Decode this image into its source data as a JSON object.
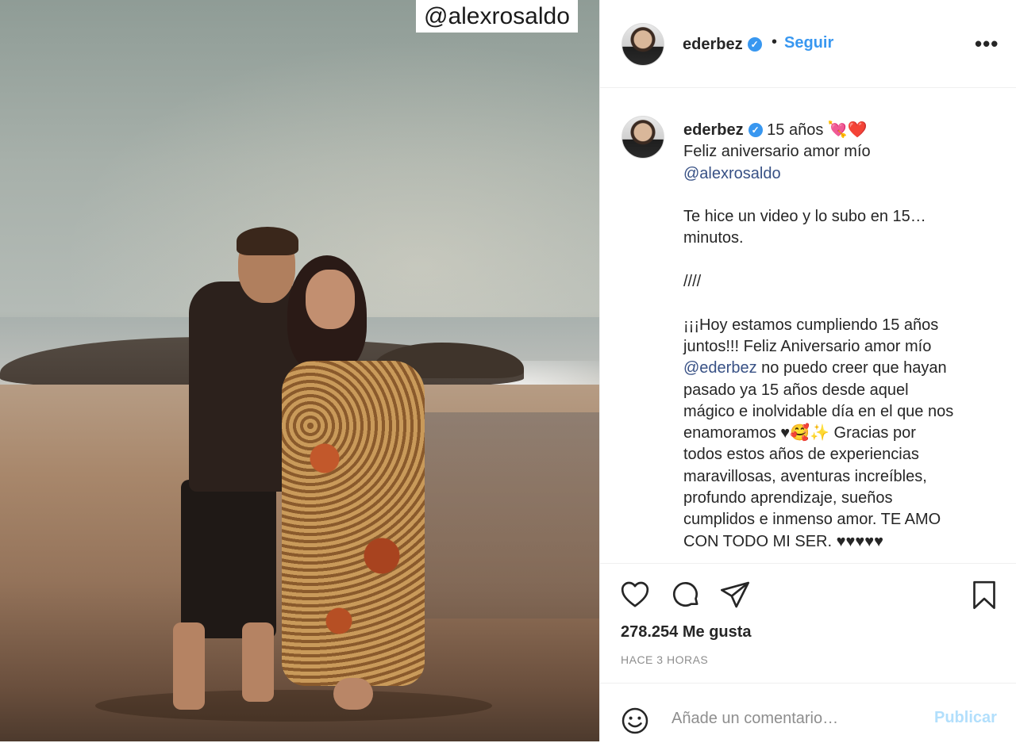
{
  "photo": {
    "watermark": "@alexrosaldo"
  },
  "header": {
    "username": "ederbez",
    "separator": "•",
    "follow_label": "Seguir",
    "more_label": "•••"
  },
  "caption": {
    "username": "ederbez",
    "line1": " 15 años ",
    "emoji1": "💘",
    "emoji2": "❤️",
    "line2": "Feliz aniversario amor mío",
    "mention1": "@alexrosaldo",
    "para2": "Te hice un video y lo subo en 15…\nminutos.",
    "para3": "////",
    "para4a": "¡¡¡Hoy estamos cumpliendo 15 años\njuntos!!! Feliz Aniversario amor mío\n",
    "mention2": "@ederbez",
    "para4b": " no puedo creer que hayan\npasado ya 15 años desde aquel\nmágico e inolvidable día en el que nos\nenamoramos ♥",
    "emoji3": "🥰",
    "emoji4": "✨",
    "para4c": " Gracias por\ntodos estos años de experiencias\nmaravillosas, aventuras increíbles,\nprofundo aprendizaje, sueños\ncumplidos e inmenso amor. TE AMO\nCON TODO MI SER. ♥♥♥♥♥"
  },
  "actions": {
    "like_icon": "heart-icon",
    "comment_icon": "comment-icon",
    "share_icon": "share-icon",
    "save_icon": "bookmark-icon",
    "likes_text": "278.254 Me gusta",
    "time_text": "HACE 3 HORAS"
  },
  "comment": {
    "placeholder": "Añade un comentario…",
    "publish_label": "Publicar"
  },
  "colors": {
    "accent": "#3897f0",
    "publish_disabled": "#b2dffc",
    "mention": "#385185"
  }
}
